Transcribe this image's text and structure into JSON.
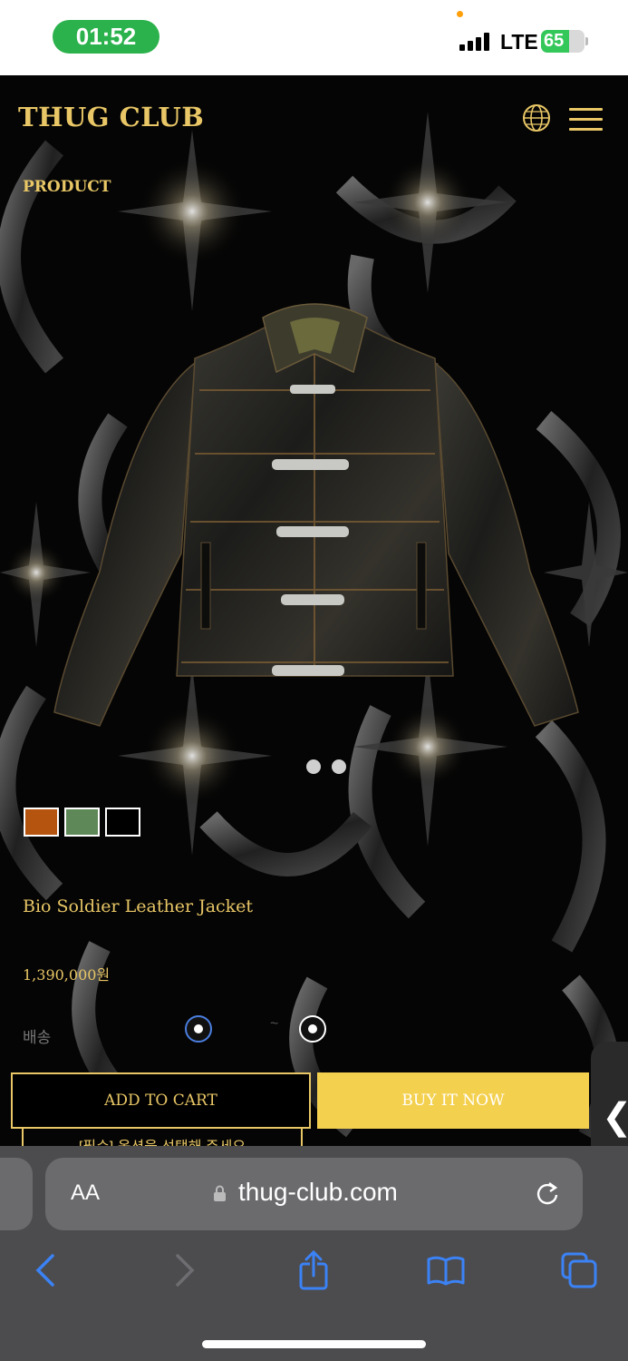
{
  "status_bar": {
    "time": "01:52",
    "network": "LTE",
    "battery": "65",
    "battery_level": 0.65
  },
  "header": {
    "logo": "THUG CLUB",
    "globe_icon": "globe-icon",
    "menu_icon": "hamburger-menu-icon"
  },
  "breadcrumb": "PRODUCT",
  "product": {
    "name": "Bio Soldier Leather Jacket",
    "price": "1,390,000원",
    "slide_count": 2,
    "colors": [
      "#b5540f",
      "#5e8858",
      "#000000"
    ],
    "shipping_label": "배송",
    "shipping_option_2_partial": "~"
  },
  "actions": {
    "add_to_cart": "ADD TO CART",
    "buy_now": "BUY IT NOW",
    "notice": "[필수] 옵션을 선택해 주세요"
  },
  "browser": {
    "aa_label": "AA",
    "url": "thug-club.com",
    "toolbar": [
      "back-icon",
      "forward-icon",
      "share-icon",
      "bookmarks-icon",
      "tabs-icon"
    ]
  },
  "colors": {
    "gold": "#e9c766",
    "buy_button": "#f4d04f",
    "safari_bg": "#4c4c4e"
  }
}
